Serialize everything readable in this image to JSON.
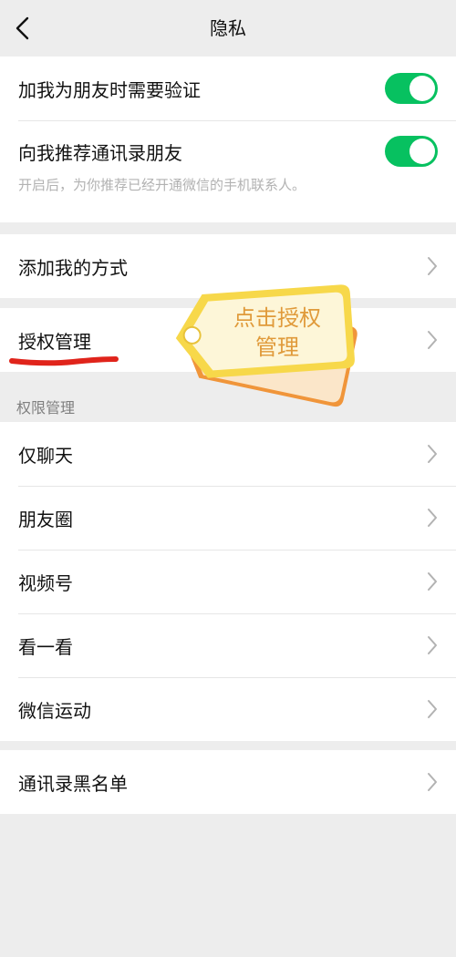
{
  "header": {
    "title": "隐私",
    "back_icon": "chevron-left-icon"
  },
  "group_friend": {
    "items": [
      {
        "label": "加我为朋友时需要验证",
        "toggle": true
      },
      {
        "label": "向我推荐通讯录朋友",
        "toggle": true
      }
    ],
    "hint": "开启后，为你推荐已经开通微信的手机联系人。"
  },
  "add_method": {
    "label": "添加我的方式"
  },
  "auth": {
    "label": "授权管理"
  },
  "annotation": {
    "line1": "点击授权",
    "line2": "管理"
  },
  "permission": {
    "section_label": "权限管理",
    "items": [
      "仅聊天",
      "朋友圈",
      "视频号",
      "看一看",
      "微信运动"
    ]
  },
  "blacklist": {
    "label": "通讯录黑名单"
  },
  "colors": {
    "toggle_on": "#07c160",
    "annotation_underline": "#e0241b",
    "tag": "#f7d84a"
  }
}
